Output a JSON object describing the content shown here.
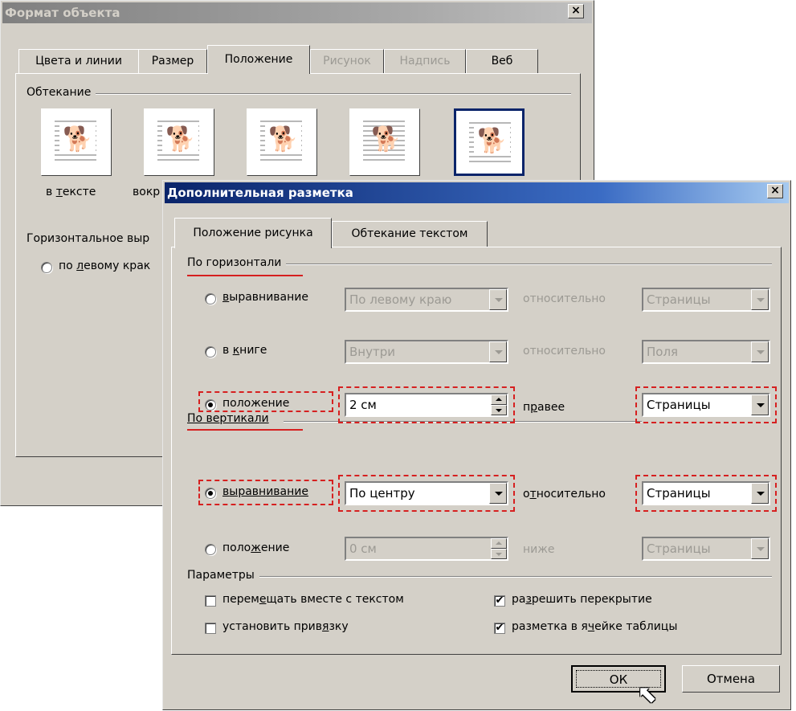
{
  "back_dialog": {
    "title": "Формат объекта",
    "close": "×",
    "tabs": [
      {
        "label": "Цвета и линии",
        "state": "normal"
      },
      {
        "label": "Размер",
        "state": "normal"
      },
      {
        "label": "Положение",
        "state": "active"
      },
      {
        "label": "Рисунок",
        "state": "disabled"
      },
      {
        "label": "Надпись",
        "state": "disabled"
      },
      {
        "label": "Веб",
        "state": "normal"
      }
    ],
    "wrap_group": "Обтекание",
    "wrap_styles": [
      {
        "label_pre": "в ",
        "label_u": "т",
        "label_post": "ексте"
      },
      {
        "label_pre": "вокр",
        "label_u": "",
        "label_post": ""
      }
    ],
    "horizontal_group": "Горизонтальное выр",
    "left_radio": {
      "pre": "по ",
      "u": "л",
      "post": "евому крак"
    },
    "dog_glyph": "🐕"
  },
  "front_dialog": {
    "title": "Дополнительная разметка",
    "close": "×",
    "tabs": [
      {
        "label": "Положение рисунка",
        "state": "active"
      },
      {
        "label": "Обтекание текстом",
        "state": "normal"
      }
    ],
    "horizontal": {
      "group": "По горизонтали",
      "rows": [
        {
          "radio_pre": "",
          "radio_u": "в",
          "radio_post": "ыравнивание",
          "value": "По левому краю",
          "rel_label": "относительно",
          "rel_value": "Страницы",
          "enabled": false,
          "checked": false
        },
        {
          "radio_pre": "в ",
          "radio_u": "к",
          "radio_post": "ниге",
          "value": "Внутри",
          "rel_label": "относительно",
          "rel_value": "Поля",
          "enabled": false,
          "checked": false
        },
        {
          "radio_pre": "",
          "radio_u": "",
          "radio_post": "положение",
          "value": "2 см",
          "rel_label_pre": "п",
          "rel_label_u": "р",
          "rel_label_post": "авее",
          "rel_value": "Страницы",
          "enabled": true,
          "checked": true
        }
      ]
    },
    "vertical": {
      "group": "По вертикали",
      "rows": [
        {
          "radio_pre": "",
          "radio_u": "в",
          "radio_post": "ыравнивание",
          "value": "По центру",
          "rel_label_pre": "о",
          "rel_label_u": "т",
          "rel_label_post": "носительно",
          "rel_value": "Страницы",
          "enabled": true,
          "checked": true
        },
        {
          "radio_pre": "поло",
          "radio_u": "ж",
          "radio_post": "ение",
          "value": "0 см",
          "rel_label": "ниже",
          "rel_value": "Страницы",
          "enabled": false,
          "checked": false
        }
      ]
    },
    "params": {
      "group": "Параметры",
      "checks": [
        {
          "pre": "перем",
          "u": "е",
          "post": "щать вместе с текстом",
          "checked": false
        },
        {
          "pre": "установить прив",
          "u": "я",
          "post": "зку",
          "checked": false
        },
        {
          "pre": "ра",
          "u": "з",
          "post": "решить перекрытие",
          "checked": true
        },
        {
          "pre": "разметка в я",
          "u": "ч",
          "post": "ейке таблицы",
          "checked": true
        }
      ]
    },
    "buttons": {
      "ok": "ОК",
      "cancel": "Отмена"
    },
    "check_mark": "✔",
    "cursor_glyph": "⬉"
  },
  "colors": {
    "highlight": "#d62020",
    "title_active": "#0a246a",
    "face": "#d4d0c8"
  }
}
